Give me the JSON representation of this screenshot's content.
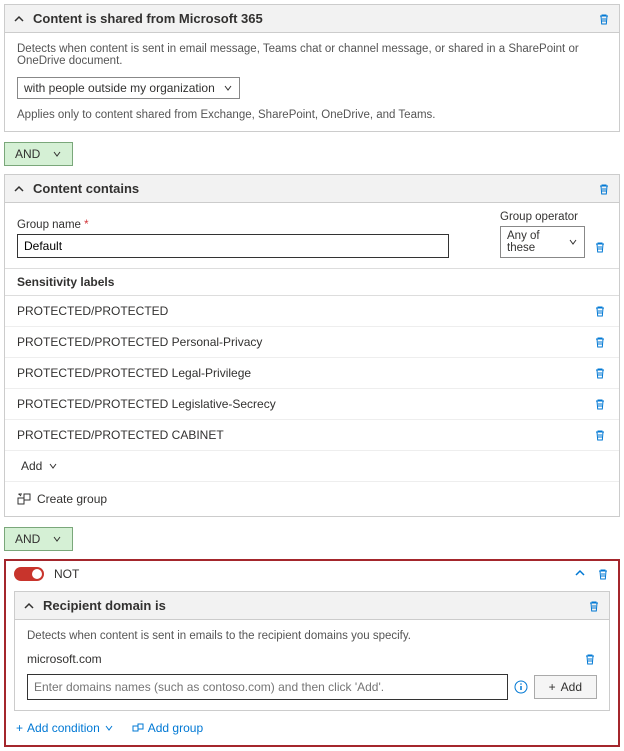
{
  "panel1": {
    "title": "Content is shared from Microsoft 365",
    "desc": "Detects when content is sent in email message, Teams chat or channel message, or shared in a SharePoint or OneDrive document.",
    "select_value": "with people outside my organization",
    "note": "Applies only to content shared from Exchange, SharePoint, OneDrive, and Teams."
  },
  "operator1": "AND",
  "panel2": {
    "title": "Content contains",
    "group_name_label": "Group name",
    "group_name_value": "Default",
    "group_operator_label": "Group operator",
    "group_operator_value": "Any of these",
    "sens_header": "Sensitivity labels",
    "labels": [
      "PROTECTED/PROTECTED",
      "PROTECTED/PROTECTED Personal-Privacy",
      "PROTECTED/PROTECTED Legal-Privilege",
      "PROTECTED/PROTECTED Legislative-Secrecy",
      "PROTECTED/PROTECTED CABINET"
    ],
    "add_label": "Add",
    "create_group_label": "Create group"
  },
  "operator2": "AND",
  "not_block": {
    "not_label": "NOT",
    "panel_title": "Recipient domain is",
    "desc": "Detects when content is sent in emails to the recipient domains you specify.",
    "domain_value": "microsoft.com",
    "input_placeholder": "Enter domains names (such as contoso.com) and then click 'Add'.",
    "add_btn": "Add",
    "add_condition": "Add condition",
    "add_group": "Add group"
  }
}
